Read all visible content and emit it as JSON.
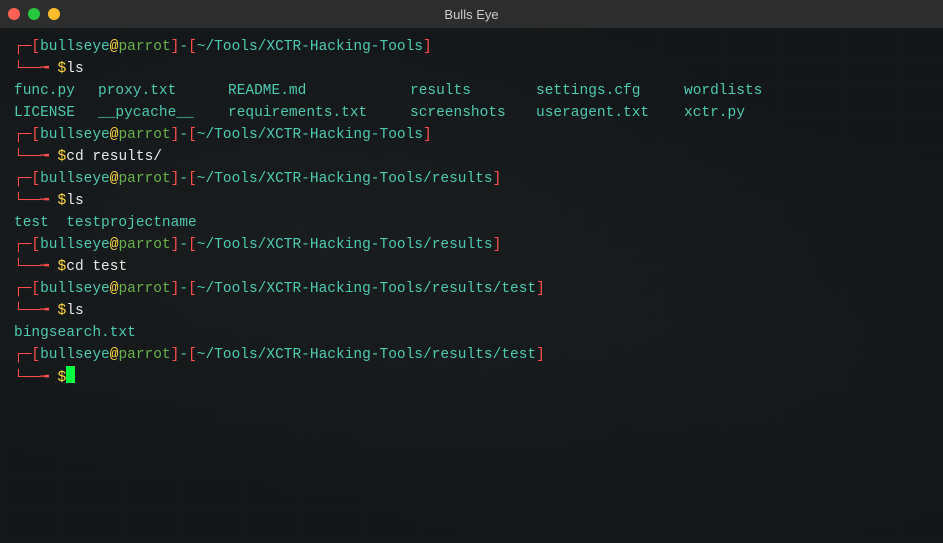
{
  "window": {
    "title": "Bulls Eye"
  },
  "prompts": {
    "user": "bullseye",
    "at": "@",
    "host": "parrot",
    "sep_dash": "-",
    "dollar": "$",
    "path1": "~/Tools/XCTR-Hacking-Tools",
    "path2": "~/Tools/XCTR-Hacking-Tools/results",
    "path3": "~/Tools/XCTR-Hacking-Tools/results/test"
  },
  "commands": {
    "ls": "ls",
    "cd_results": "cd results/",
    "cd_test": "cd test"
  },
  "listing1": {
    "r1c1": "func.py",
    "r1c2": "proxy.txt",
    "r1c3": "README.md",
    "r1c4": "results",
    "r1c5": "settings.cfg",
    "r1c6": "wordlists",
    "r2c1": "LICENSE",
    "r2c2": "__pycache__",
    "r2c3": "requirements.txt",
    "r2c4": "screenshots",
    "r2c5": "useragent.txt",
    "r2c6": "xctr.py"
  },
  "listing2": {
    "item1": "test",
    "item2": "testprojectname"
  },
  "listing3": {
    "item1": "bingsearch.txt"
  },
  "marker": {
    "top": "┌─",
    "mid": "│ ",
    "bottom": "└──╼ "
  },
  "brackets": {
    "open": "[",
    "close": "]",
    "tilde": "~"
  }
}
